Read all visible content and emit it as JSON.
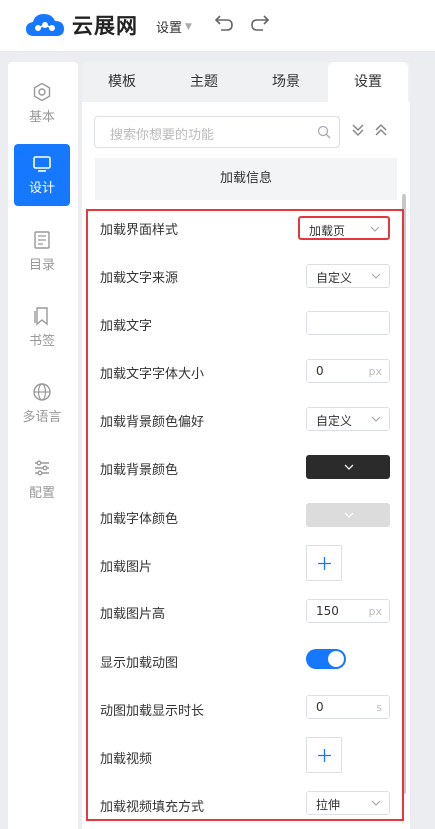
{
  "header": {
    "logo_text": "云展网",
    "settings_menu": "设置",
    "undo_icon": "undo-icon",
    "redo_icon": "redo-icon"
  },
  "sidebar": {
    "items": [
      {
        "label": "基本",
        "icon": "hexagon-icon",
        "active": false
      },
      {
        "label": "设计",
        "icon": "monitor-icon",
        "active": true
      },
      {
        "label": "目录",
        "icon": "document-icon",
        "active": false
      },
      {
        "label": "书签",
        "icon": "bookmark-icon",
        "active": false
      },
      {
        "label": "多语言",
        "icon": "globe-icon",
        "active": false
      },
      {
        "label": "配置",
        "icon": "sliders-icon",
        "active": false
      }
    ]
  },
  "tabs": [
    {
      "label": "模板",
      "active": false
    },
    {
      "label": "主题",
      "active": false
    },
    {
      "label": "场景",
      "active": false
    },
    {
      "label": "设置",
      "active": true
    }
  ],
  "search": {
    "placeholder": "搜索你想要的功能"
  },
  "section_title": "加载信息",
  "rows": [
    {
      "label": "加载界面样式",
      "type": "select",
      "value": "加载页",
      "highlighted": true
    },
    {
      "label": "加载文字来源",
      "type": "select",
      "value": "自定义"
    },
    {
      "label": "加载文字",
      "type": "text",
      "value": ""
    },
    {
      "label": "加载文字字体大小",
      "type": "number",
      "value": "0",
      "unit": "px"
    },
    {
      "label": "加载背景颜色偏好",
      "type": "select",
      "value": "自定义"
    },
    {
      "label": "加载背景颜色",
      "type": "color",
      "value": "#2b2b2b"
    },
    {
      "label": "加载字体颜色",
      "type": "color",
      "value": "#dcdcdc"
    },
    {
      "label": "加载图片",
      "type": "add"
    },
    {
      "label": "加载图片高",
      "type": "number",
      "value": "150",
      "unit": "px"
    },
    {
      "label": "显示加载动图",
      "type": "toggle",
      "value": true
    },
    {
      "label": "动图加载显示时长",
      "type": "number",
      "value": "0",
      "unit": "s"
    },
    {
      "label": "加载视频",
      "type": "add"
    },
    {
      "label": "加载视频填充方式",
      "type": "select",
      "value": "拉伸"
    }
  ],
  "colors": {
    "accent": "#1677ff",
    "highlight": "#e4393c"
  }
}
